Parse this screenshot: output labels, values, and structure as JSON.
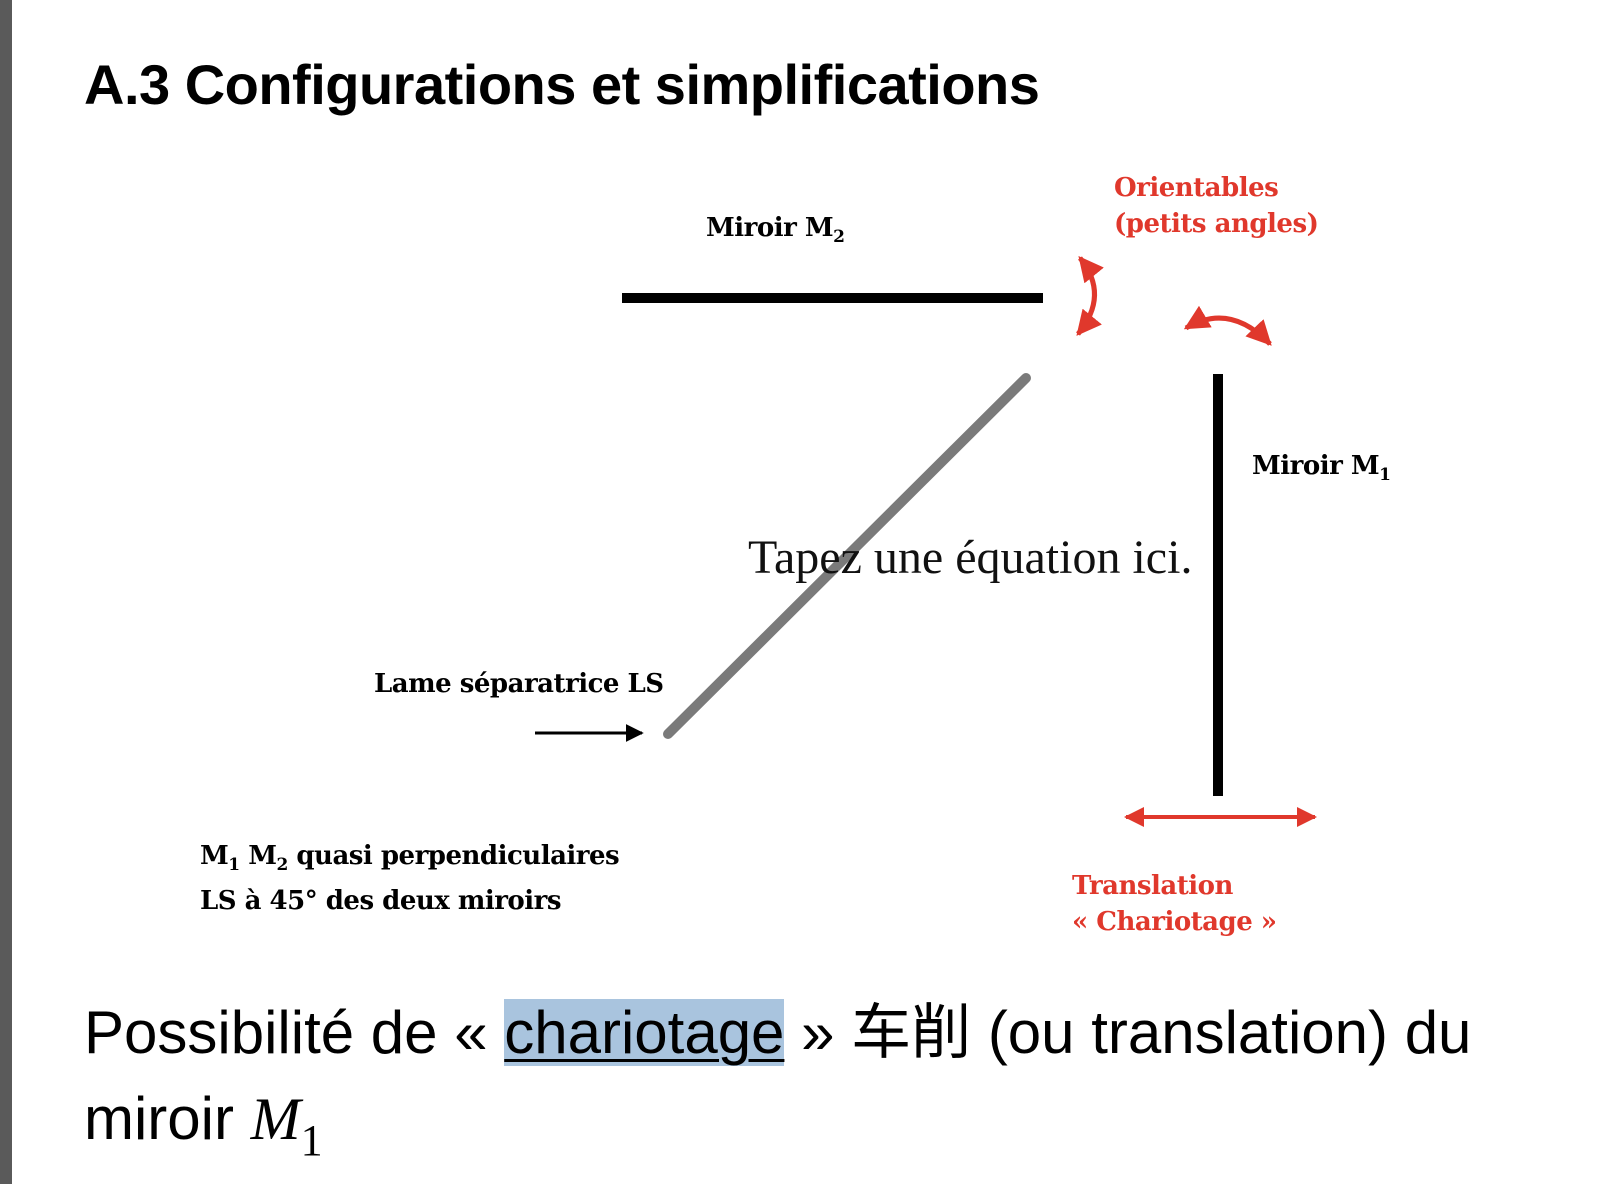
{
  "title": "A.3 Configurations et simplifications",
  "figure": {
    "mirror_m2_label": "Miroir M",
    "mirror_m2_sub": "2",
    "orientables_line1": "Orientables",
    "orientables_line2": "(petits angles)",
    "mirror_m1_label": "Miroir M",
    "mirror_m1_sub": "1",
    "beam_splitter_label": "Lame  séparatrice LS",
    "note_m": "M",
    "note_sub1": "1",
    "note_sub2": "2",
    "note_line1_rest": " quasi perpendiculaires",
    "note_line2": "LS à 45° des deux miroirs",
    "translation_line1": "Translation",
    "translation_line2": "« Chariotage »",
    "accent_color": "#e0382c"
  },
  "equation_placeholder": "Tapez une équation ici.",
  "caption": {
    "before": "Possibilité de « ",
    "highlighted": "chariotage",
    "after": " » ",
    "cjk": "车削",
    "rest": " (ou translation) du miroir ",
    "math_var": "M",
    "math_sub": "1"
  }
}
